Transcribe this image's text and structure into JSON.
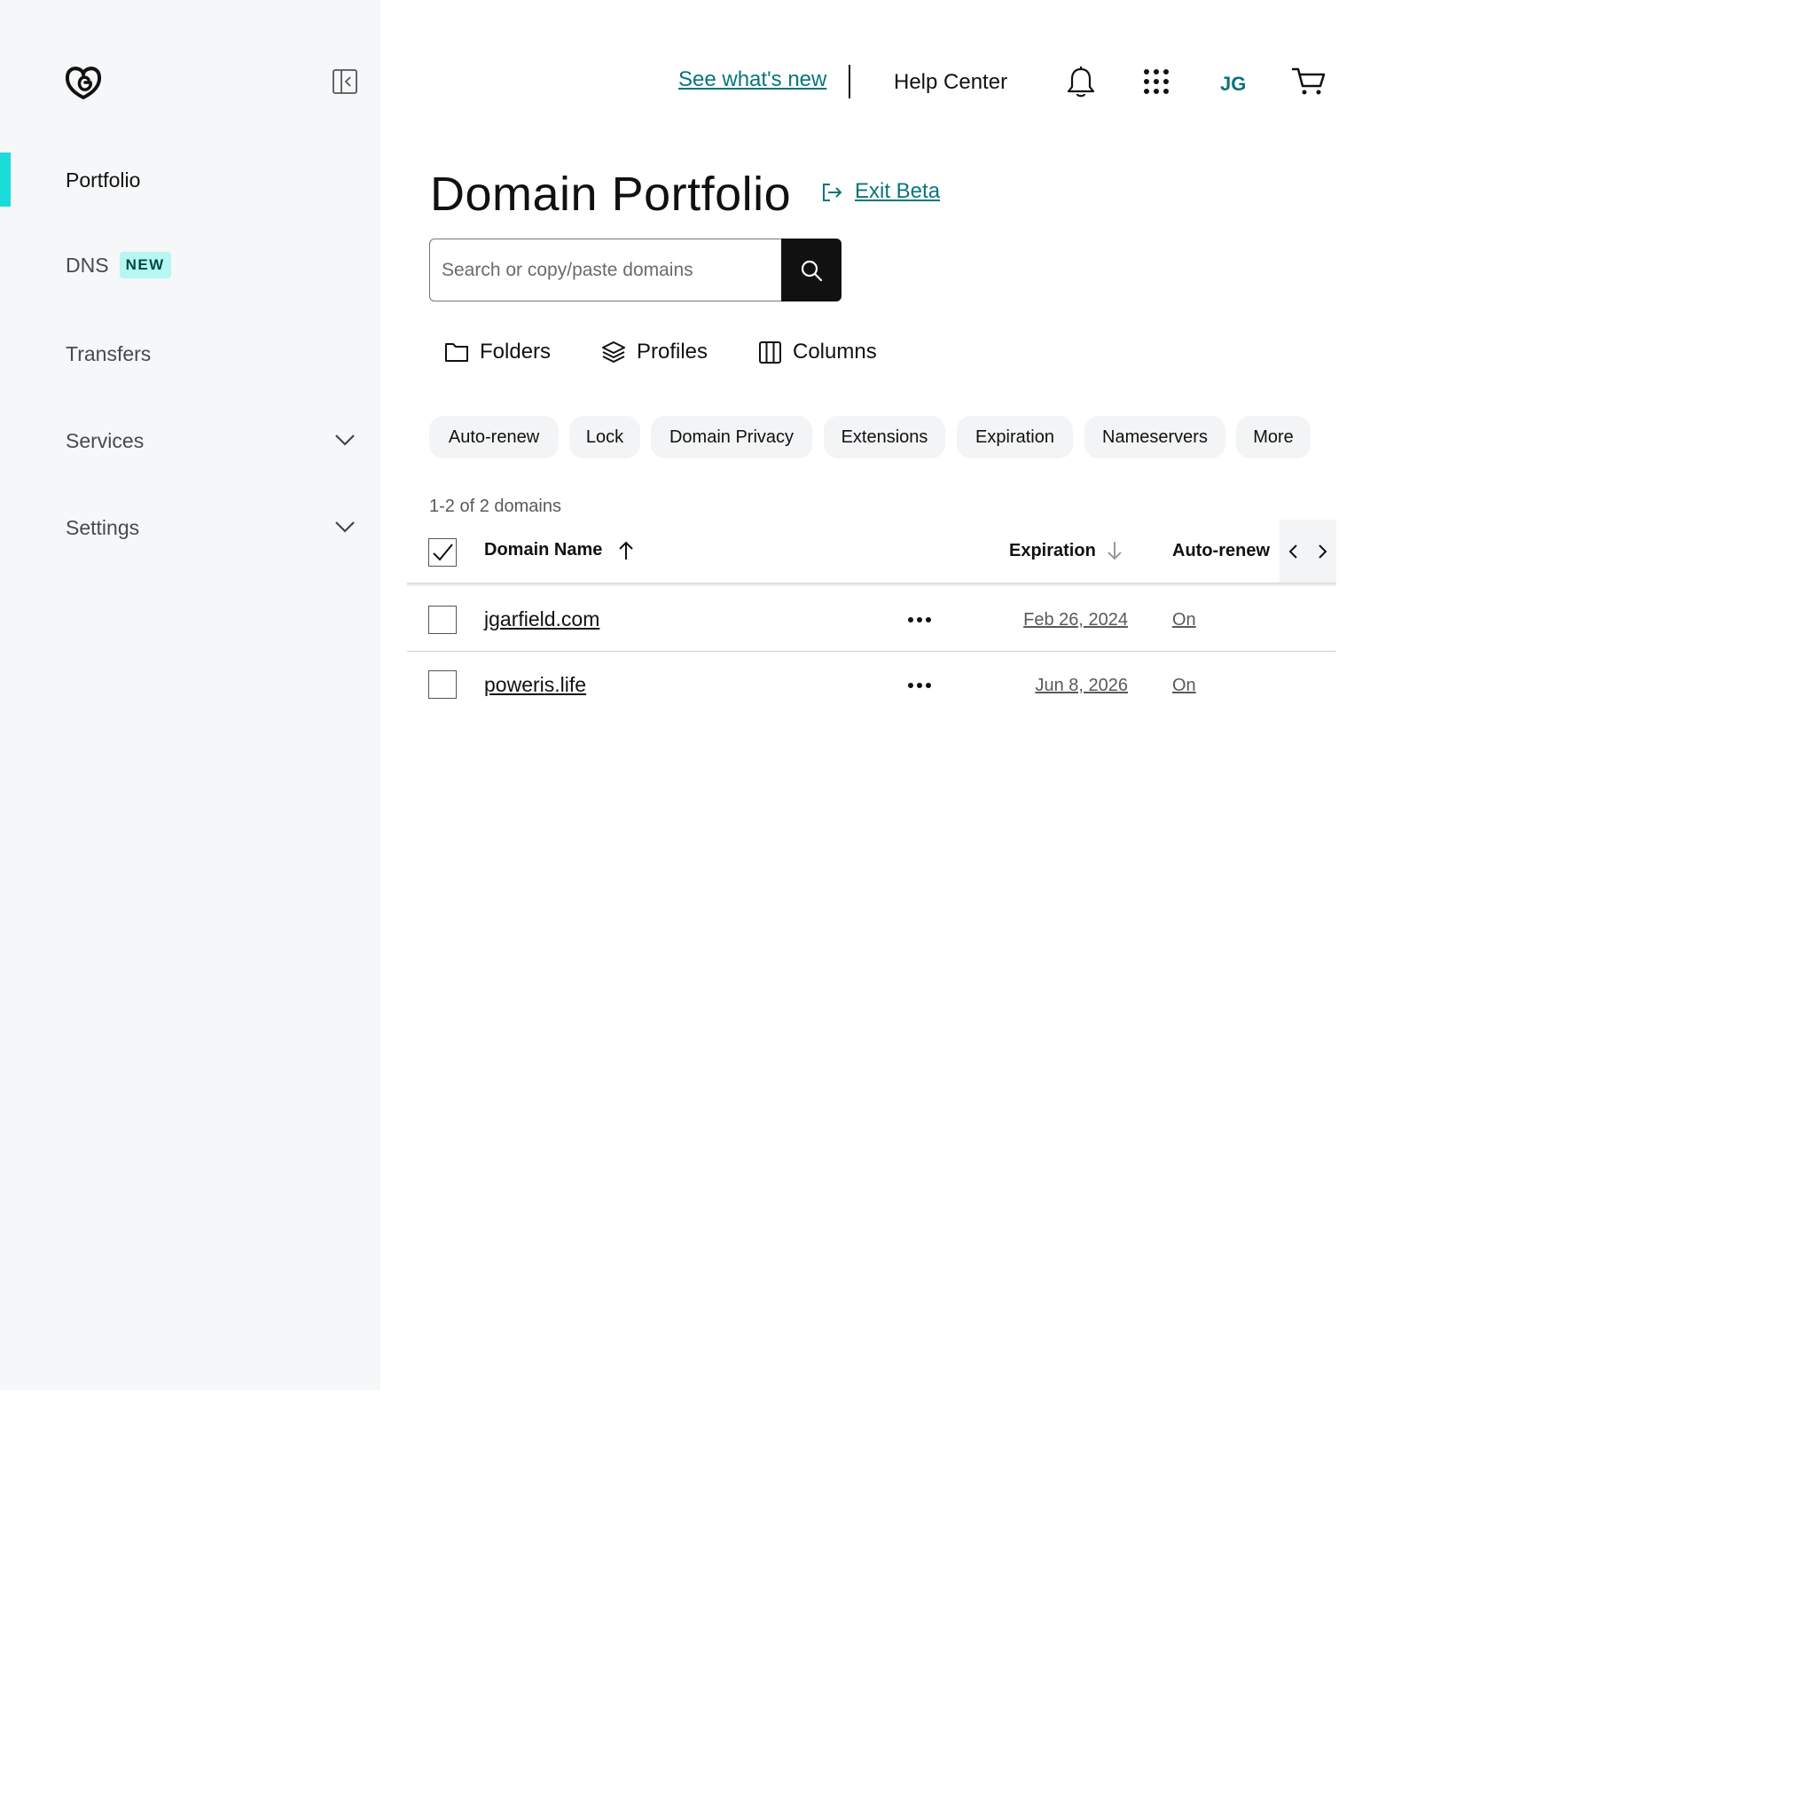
{
  "sidebar": {
    "logo_icon": "godaddy-logo-icon",
    "collapse_icon": "sidebar-collapse-icon",
    "items": [
      {
        "label": "Portfolio",
        "active": true
      },
      {
        "label": "DNS",
        "badge": "NEW"
      },
      {
        "label": "Transfers"
      },
      {
        "label": "Services",
        "expandable": true
      },
      {
        "label": "Settings",
        "expandable": true
      }
    ]
  },
  "header": {
    "whats_new": "See what's new",
    "help_center": "Help Center",
    "avatar_initials": "JG",
    "icons": [
      "bell-icon",
      "apps-grid-icon",
      "cart-icon"
    ]
  },
  "page": {
    "title": "Domain Portfolio",
    "exit_beta": "Exit Beta"
  },
  "search": {
    "placeholder": "Search or copy/paste domains",
    "value": ""
  },
  "toolbar": {
    "folders": "Folders",
    "profiles": "Profiles",
    "columns": "Columns"
  },
  "filters": [
    "Auto-renew",
    "Lock",
    "Domain Privacy",
    "Extensions",
    "Expiration",
    "Nameservers",
    "More"
  ],
  "table": {
    "count_label": "1-2 of 2 domains",
    "headers": {
      "domain_name": "Domain Name",
      "expiration": "Expiration",
      "auto_renew": "Auto-renew"
    },
    "rows": [
      {
        "domain": "jgarfield.com",
        "expiration": "Feb 26, 2024",
        "auto_renew": "On"
      },
      {
        "domain": "poweris.life",
        "expiration": "Jun 8, 2026",
        "auto_renew": "On"
      }
    ]
  },
  "colors": {
    "accent_teal": "#09757a",
    "active_bar": "#1bdbdb",
    "badge_bg": "#b6f7f2",
    "sidebar_bg": "#f5f7f8"
  }
}
